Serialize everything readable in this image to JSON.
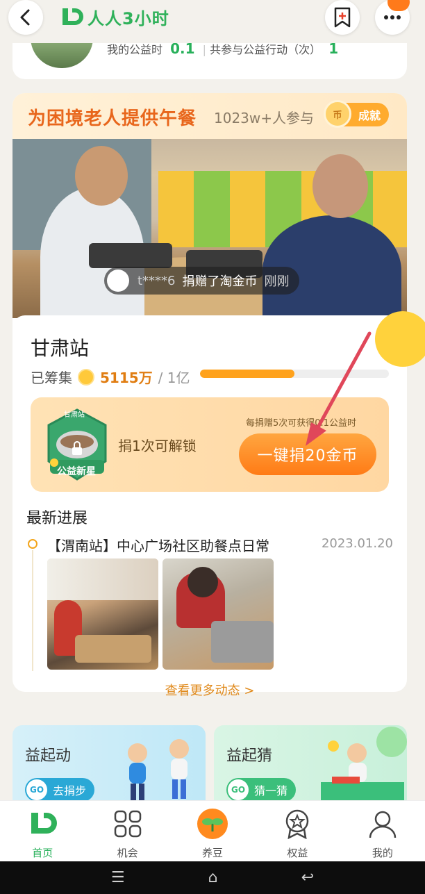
{
  "app": {
    "logo_text": "人人3小时"
  },
  "stats": {
    "label_hours": "我的公益时",
    "hours": "0.1",
    "label_actions": "共参与公益行动（次）",
    "actions": "1"
  },
  "campaign": {
    "title": "为困境老人提供午餐",
    "participants": "1023w+人参与",
    "achievement_label": "成就",
    "coin_glyph": "币",
    "donation_ticker": {
      "user": "t****6",
      "action": "捐赠了淘金币",
      "time": "刚刚"
    },
    "station": "甘肃站",
    "raised_label": "已筹集",
    "raised_amount": "5115万",
    "goal": "/ 1亿",
    "progress_fraction": 0.5,
    "badge_top": "甘肃站",
    "badge_bottom": "公益新星",
    "unlock_text": "捐1次可解锁",
    "hint": "每捐赠5次可获得0.1公益时",
    "donate_button": "一键捐20金币"
  },
  "news": {
    "section_title": "最新进展",
    "item_title": "【渭南站】中心广场社区助餐点日常",
    "item_date": "2023.01.20",
    "more_link": "查看更多动态 >"
  },
  "features": [
    {
      "title": "益起动",
      "go": "GO",
      "action": "去捐步"
    },
    {
      "title": "益起猜",
      "go": "GO",
      "action": "猜一猜"
    }
  ],
  "tabs": [
    {
      "label": "首页",
      "icon": "home-icon",
      "active": true
    },
    {
      "label": "机会",
      "icon": "grid-icon",
      "active": false
    },
    {
      "label": "养豆",
      "icon": "sprout-icon",
      "active": false
    },
    {
      "label": "权益",
      "icon": "medal-icon",
      "active": false
    },
    {
      "label": "我的",
      "icon": "user-icon",
      "active": false
    }
  ],
  "colors": {
    "brand_green": "#27b05a",
    "accent_orange": "#ff7b16",
    "amount_orange": "#e07d12"
  }
}
